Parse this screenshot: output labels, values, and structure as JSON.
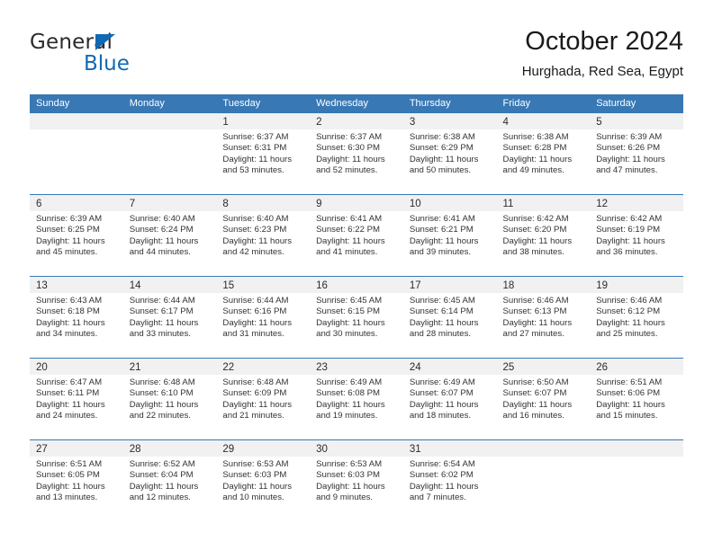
{
  "brand": {
    "name_part1": "General",
    "name_part2": "Blue",
    "accent_color": "#1268b3"
  },
  "header": {
    "title": "October 2024",
    "subtitle": "Hurghada, Red Sea, Egypt"
  },
  "theme": {
    "header_bar_color": "#3878b4",
    "day_band_color": "#f1f1f1",
    "row_divider_color": "#3878b4"
  },
  "weekday_headers": [
    "Sunday",
    "Monday",
    "Tuesday",
    "Wednesday",
    "Thursday",
    "Friday",
    "Saturday"
  ],
  "labels": {
    "sunrise_prefix": "Sunrise:",
    "sunset_prefix": "Sunset:",
    "daylight_prefix": "Daylight:"
  },
  "weeks": [
    [
      {
        "day": "",
        "line1": "",
        "line2": "",
        "line3": "",
        "line4": ""
      },
      {
        "day": "",
        "line1": "",
        "line2": "",
        "line3": "",
        "line4": ""
      },
      {
        "day": "1",
        "line1": "Sunrise: 6:37 AM",
        "line2": "Sunset: 6:31 PM",
        "line3": "Daylight: 11 hours",
        "line4": "and 53 minutes."
      },
      {
        "day": "2",
        "line1": "Sunrise: 6:37 AM",
        "line2": "Sunset: 6:30 PM",
        "line3": "Daylight: 11 hours",
        "line4": "and 52 minutes."
      },
      {
        "day": "3",
        "line1": "Sunrise: 6:38 AM",
        "line2": "Sunset: 6:29 PM",
        "line3": "Daylight: 11 hours",
        "line4": "and 50 minutes."
      },
      {
        "day": "4",
        "line1": "Sunrise: 6:38 AM",
        "line2": "Sunset: 6:28 PM",
        "line3": "Daylight: 11 hours",
        "line4": "and 49 minutes."
      },
      {
        "day": "5",
        "line1": "Sunrise: 6:39 AM",
        "line2": "Sunset: 6:26 PM",
        "line3": "Daylight: 11 hours",
        "line4": "and 47 minutes."
      }
    ],
    [
      {
        "day": "6",
        "line1": "Sunrise: 6:39 AM",
        "line2": "Sunset: 6:25 PM",
        "line3": "Daylight: 11 hours",
        "line4": "and 45 minutes."
      },
      {
        "day": "7",
        "line1": "Sunrise: 6:40 AM",
        "line2": "Sunset: 6:24 PM",
        "line3": "Daylight: 11 hours",
        "line4": "and 44 minutes."
      },
      {
        "day": "8",
        "line1": "Sunrise: 6:40 AM",
        "line2": "Sunset: 6:23 PM",
        "line3": "Daylight: 11 hours",
        "line4": "and 42 minutes."
      },
      {
        "day": "9",
        "line1": "Sunrise: 6:41 AM",
        "line2": "Sunset: 6:22 PM",
        "line3": "Daylight: 11 hours",
        "line4": "and 41 minutes."
      },
      {
        "day": "10",
        "line1": "Sunrise: 6:41 AM",
        "line2": "Sunset: 6:21 PM",
        "line3": "Daylight: 11 hours",
        "line4": "and 39 minutes."
      },
      {
        "day": "11",
        "line1": "Sunrise: 6:42 AM",
        "line2": "Sunset: 6:20 PM",
        "line3": "Daylight: 11 hours",
        "line4": "and 38 minutes."
      },
      {
        "day": "12",
        "line1": "Sunrise: 6:42 AM",
        "line2": "Sunset: 6:19 PM",
        "line3": "Daylight: 11 hours",
        "line4": "and 36 minutes."
      }
    ],
    [
      {
        "day": "13",
        "line1": "Sunrise: 6:43 AM",
        "line2": "Sunset: 6:18 PM",
        "line3": "Daylight: 11 hours",
        "line4": "and 34 minutes."
      },
      {
        "day": "14",
        "line1": "Sunrise: 6:44 AM",
        "line2": "Sunset: 6:17 PM",
        "line3": "Daylight: 11 hours",
        "line4": "and 33 minutes."
      },
      {
        "day": "15",
        "line1": "Sunrise: 6:44 AM",
        "line2": "Sunset: 6:16 PM",
        "line3": "Daylight: 11 hours",
        "line4": "and 31 minutes."
      },
      {
        "day": "16",
        "line1": "Sunrise: 6:45 AM",
        "line2": "Sunset: 6:15 PM",
        "line3": "Daylight: 11 hours",
        "line4": "and 30 minutes."
      },
      {
        "day": "17",
        "line1": "Sunrise: 6:45 AM",
        "line2": "Sunset: 6:14 PM",
        "line3": "Daylight: 11 hours",
        "line4": "and 28 minutes."
      },
      {
        "day": "18",
        "line1": "Sunrise: 6:46 AM",
        "line2": "Sunset: 6:13 PM",
        "line3": "Daylight: 11 hours",
        "line4": "and 27 minutes."
      },
      {
        "day": "19",
        "line1": "Sunrise: 6:46 AM",
        "line2": "Sunset: 6:12 PM",
        "line3": "Daylight: 11 hours",
        "line4": "and 25 minutes."
      }
    ],
    [
      {
        "day": "20",
        "line1": "Sunrise: 6:47 AM",
        "line2": "Sunset: 6:11 PM",
        "line3": "Daylight: 11 hours",
        "line4": "and 24 minutes."
      },
      {
        "day": "21",
        "line1": "Sunrise: 6:48 AM",
        "line2": "Sunset: 6:10 PM",
        "line3": "Daylight: 11 hours",
        "line4": "and 22 minutes."
      },
      {
        "day": "22",
        "line1": "Sunrise: 6:48 AM",
        "line2": "Sunset: 6:09 PM",
        "line3": "Daylight: 11 hours",
        "line4": "and 21 minutes."
      },
      {
        "day": "23",
        "line1": "Sunrise: 6:49 AM",
        "line2": "Sunset: 6:08 PM",
        "line3": "Daylight: 11 hours",
        "line4": "and 19 minutes."
      },
      {
        "day": "24",
        "line1": "Sunrise: 6:49 AM",
        "line2": "Sunset: 6:07 PM",
        "line3": "Daylight: 11 hours",
        "line4": "and 18 minutes."
      },
      {
        "day": "25",
        "line1": "Sunrise: 6:50 AM",
        "line2": "Sunset: 6:07 PM",
        "line3": "Daylight: 11 hours",
        "line4": "and 16 minutes."
      },
      {
        "day": "26",
        "line1": "Sunrise: 6:51 AM",
        "line2": "Sunset: 6:06 PM",
        "line3": "Daylight: 11 hours",
        "line4": "and 15 minutes."
      }
    ],
    [
      {
        "day": "27",
        "line1": "Sunrise: 6:51 AM",
        "line2": "Sunset: 6:05 PM",
        "line3": "Daylight: 11 hours",
        "line4": "and 13 minutes."
      },
      {
        "day": "28",
        "line1": "Sunrise: 6:52 AM",
        "line2": "Sunset: 6:04 PM",
        "line3": "Daylight: 11 hours",
        "line4": "and 12 minutes."
      },
      {
        "day": "29",
        "line1": "Sunrise: 6:53 AM",
        "line2": "Sunset: 6:03 PM",
        "line3": "Daylight: 11 hours",
        "line4": "and 10 minutes."
      },
      {
        "day": "30",
        "line1": "Sunrise: 6:53 AM",
        "line2": "Sunset: 6:03 PM",
        "line3": "Daylight: 11 hours",
        "line4": "and 9 minutes."
      },
      {
        "day": "31",
        "line1": "Sunrise: 6:54 AM",
        "line2": "Sunset: 6:02 PM",
        "line3": "Daylight: 11 hours",
        "line4": "and 7 minutes."
      },
      {
        "day": "",
        "line1": "",
        "line2": "",
        "line3": "",
        "line4": ""
      },
      {
        "day": "",
        "line1": "",
        "line2": "",
        "line3": "",
        "line4": ""
      }
    ]
  ]
}
